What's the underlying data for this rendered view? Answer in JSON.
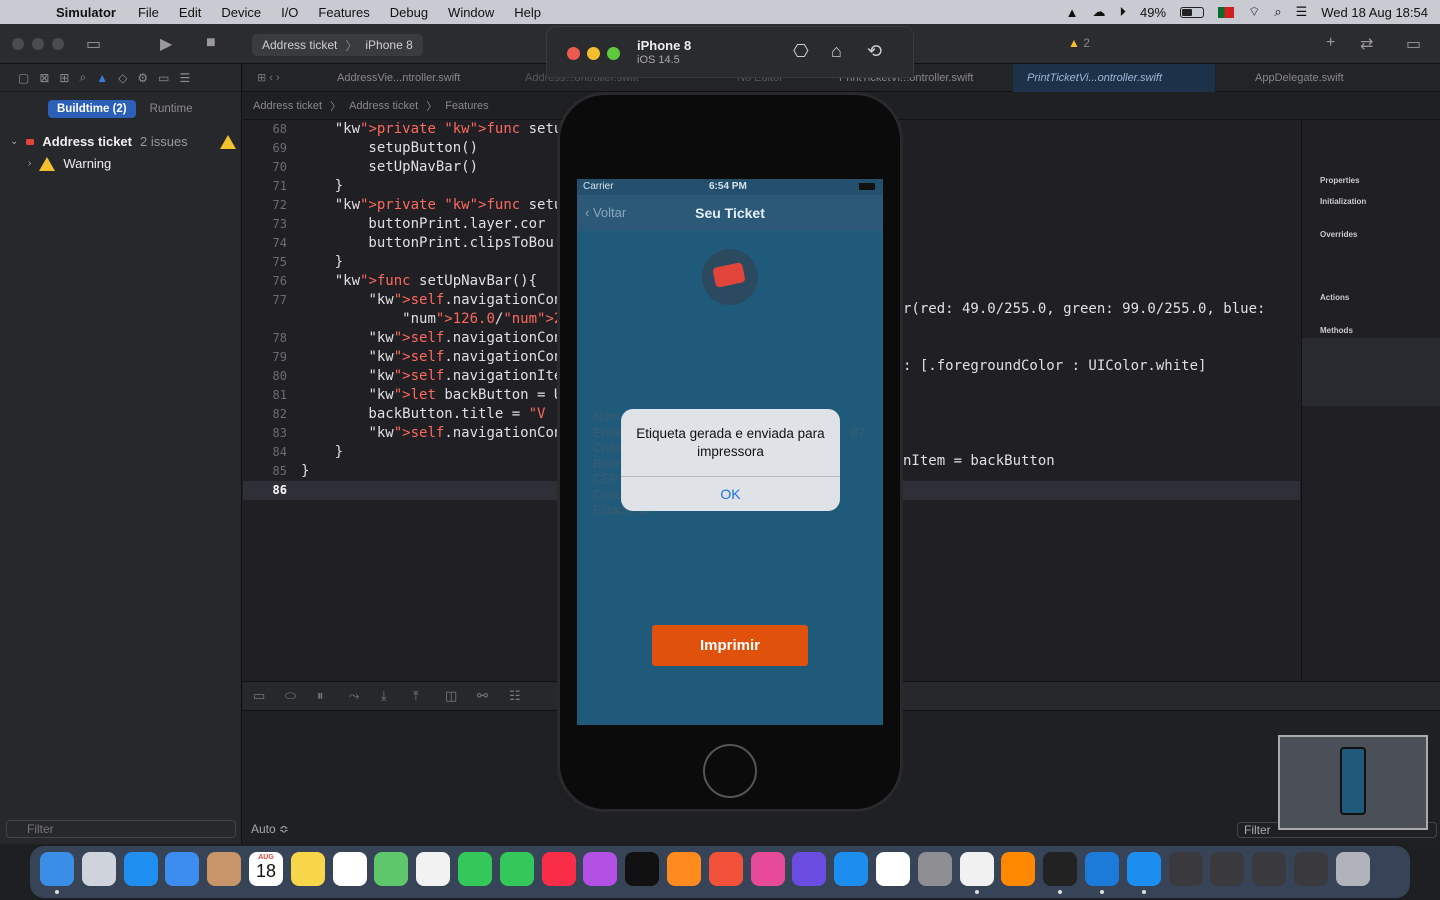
{
  "menubar": {
    "app_name": "Simulator",
    "menus": [
      "File",
      "Edit",
      "Device",
      "I/O",
      "Features",
      "Debug",
      "Window",
      "Help"
    ],
    "battery": "49%",
    "battery_level": 0.49,
    "datetime": "Wed 18 Aug  18:54"
  },
  "xcode": {
    "scheme": "Address ticket",
    "destination": "iPhone 8",
    "warning_count": "2",
    "tabs": [
      "AddressVie...ntroller.swift",
      "Address...ontroller.swift",
      "No Editor",
      "PrintTicketVi...ontroller.swift",
      "PrintTicketVi...ontroller.swift",
      "AppDelegate.swift"
    ],
    "breadcrumb": [
      "Address ticket",
      "Address ticket",
      "Features"
    ],
    "navigator": {
      "seg_active": "Buildtime (2)",
      "seg_inactive": "Runtime",
      "project": "Address ticket",
      "issues": "2 issues",
      "warning": "Warning",
      "filter_placeholder": "Filter"
    },
    "minimap_sections": [
      "Properties",
      "Initialization",
      "Overrides",
      "Actions",
      "Methods"
    ],
    "bottom": {
      "auto": "Auto ≎",
      "filter": "Filter"
    }
  },
  "code_lines": [
    {
      "n": "68",
      "text": "    private func setupUI() {"
    },
    {
      "n": "69",
      "text": "        setupButton()"
    },
    {
      "n": "70",
      "text": "        setUpNavBar()"
    },
    {
      "n": "71",
      "text": "    }"
    },
    {
      "n": "72",
      "text": "    private func setupButton("
    },
    {
      "n": "73",
      "text": "        buttonPrint.layer.cor"
    },
    {
      "n": "74",
      "text": "        buttonPrint.clipsToBou"
    },
    {
      "n": "75",
      "text": "    }"
    },
    {
      "n": "76",
      "text": "    func setUpNavBar(){"
    },
    {
      "n": "77",
      "text": "        self.navigationContro"
    },
    {
      "n": "",
      "text": "            126.0/255.0, alph"
    },
    {
      "n": "78",
      "text": "        self.navigationContro"
    },
    {
      "n": "79",
      "text": "        self.navigationContro"
    },
    {
      "n": "80",
      "text": "        self.navigationItem.t"
    },
    {
      "n": "81",
      "text": "        let backButton = UIBa"
    },
    {
      "n": "82",
      "text": "        backButton.title = \"V"
    },
    {
      "n": "83",
      "text": "        self.navigationContro"
    },
    {
      "n": "84",
      "text": "    }"
    },
    {
      "n": "85",
      "text": "}"
    },
    {
      "n": "86",
      "text": ""
    }
  ],
  "code_right": {
    "line77": "r(red: 49.0/255.0, green: 99.0/255.0, blue:",
    "line78": ": [.foregroundColor : UIColor.white]",
    "line83": "nItem = backButton"
  },
  "simulator": {
    "device": "iPhone 8",
    "os": "iOS 14.5",
    "carrier": "Carrier",
    "time": "6:54 PM",
    "back": "Voltar",
    "nav_title": "Seu Ticket",
    "fields": [
      "Nom",
      "Ende",
      "Chác",
      "Bairr",
      "CEP",
      "Cida",
      "Estado: DF"
    ],
    "field_right": "87",
    "alert_message": "Etiqueta gerada e enviada para impressora",
    "alert_ok": "OK",
    "print_button": "Imprimir"
  },
  "dock_calendar": {
    "month": "AUG",
    "day": "18"
  },
  "colors": {
    "accent": "#2b5fb8",
    "screen_bg": "#1f5a7a",
    "print_button": "#e0520c",
    "warning": "#f2c12e"
  }
}
